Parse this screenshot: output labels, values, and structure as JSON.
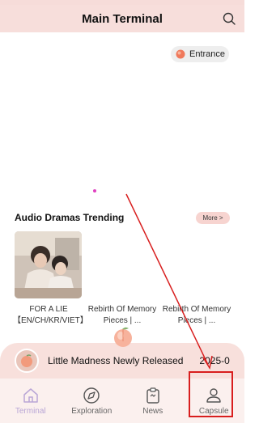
{
  "colors": {
    "header_bg": "#f7dedb",
    "accent_active": "#b9a6d6",
    "annotation_red": "#d81e1e"
  },
  "header": {
    "title": "Main Terminal",
    "search_icon": "search-icon"
  },
  "entrance": {
    "label": "Entrance"
  },
  "section": {
    "title": "Audio Dramas Trending",
    "more_label": "More >",
    "cards": [
      {
        "title": "FOR A LIE 【EN/CH/KR/VIET】"
      },
      {
        "title": "Rebirth Of Memory Pieces | ..."
      },
      {
        "title": "Rebirth Of Memory Pieces | ..."
      }
    ]
  },
  "now_playing": {
    "title": "Little Madness Newly Released",
    "date": "2025-0"
  },
  "nav": {
    "items": [
      {
        "label": "Terminal",
        "icon": "home-icon",
        "active": true
      },
      {
        "label": "Exploration",
        "icon": "compass-icon",
        "active": false
      },
      {
        "label": "News",
        "icon": "news-icon",
        "active": false
      },
      {
        "label": "Capsule",
        "icon": "profile-icon",
        "active": false
      }
    ]
  }
}
